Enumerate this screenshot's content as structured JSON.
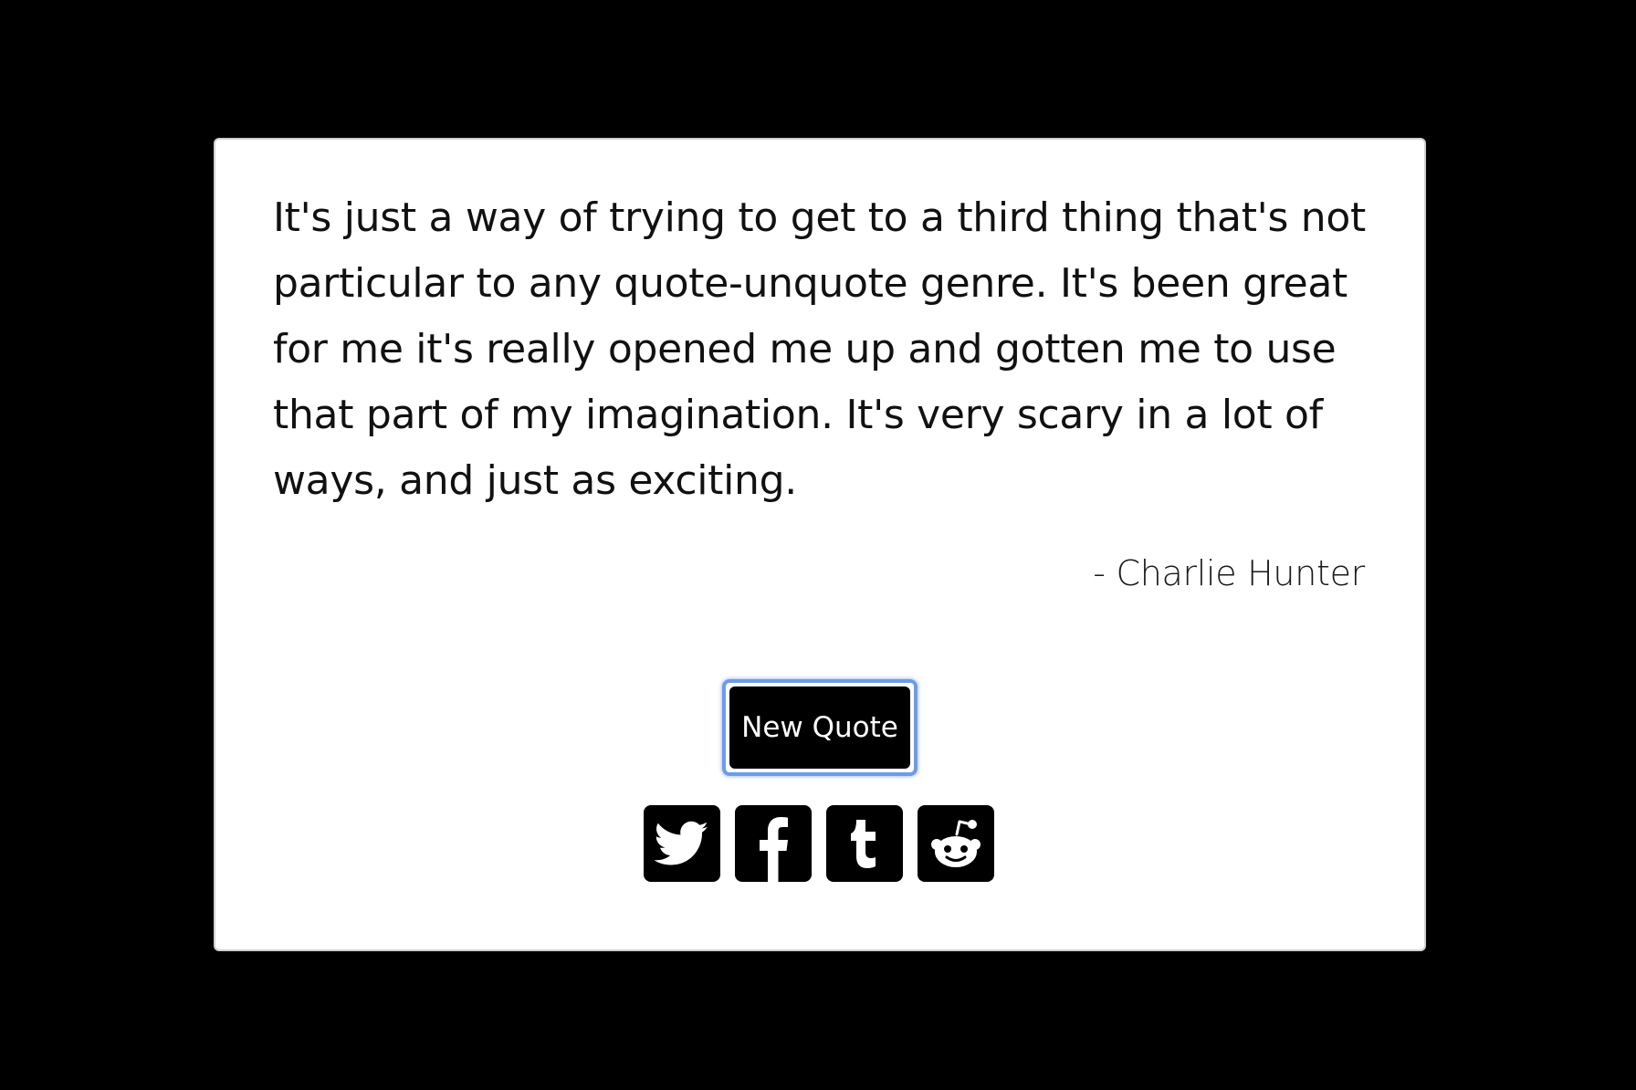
{
  "quote": {
    "text": "It's just a way of trying to get to a third thing that's not particular to any quote-unquote genre. It's been great for me it's really opened me up and gotten me to use that part of my imagination. It's very scary in a lot of ways, and just as exciting.",
    "author": "- Charlie Hunter"
  },
  "actions": {
    "new_quote_label": "New Quote"
  },
  "share": [
    {
      "icon": "twitter-icon"
    },
    {
      "icon": "facebook-icon"
    },
    {
      "icon": "tumblr-icon"
    },
    {
      "icon": "reddit-icon"
    }
  ],
  "colors": {
    "background": "#000000",
    "card": "#ffffff",
    "button": "#000000",
    "focus_ring": "#6f9be8"
  }
}
